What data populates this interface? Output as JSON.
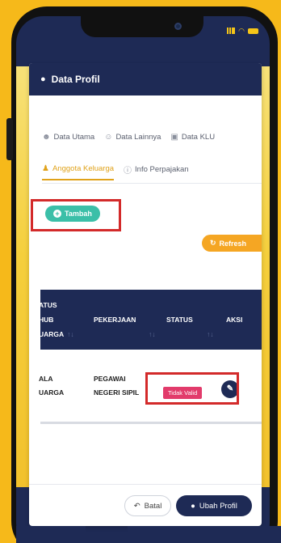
{
  "card": {
    "title": "Data Profil"
  },
  "tabs": [
    {
      "label": "Data Utama",
      "icon": "user-outline-icon"
    },
    {
      "label": "Data Lainnya",
      "icon": "user-group-icon"
    },
    {
      "label": "Data KLU",
      "icon": "cube-icon"
    },
    {
      "label": "Anggota Keluarga",
      "icon": "family-icon",
      "active": true
    },
    {
      "label": "Info Perpajakan",
      "icon": "info-circle-icon"
    }
  ],
  "actions": {
    "tambah": "Tambah",
    "refresh": "Refresh"
  },
  "table": {
    "headers": [
      {
        "line1": "ATUS",
        "line2": "HUB",
        "line3": "UARGA"
      },
      {
        "label": "PEKERJAAN"
      },
      {
        "label": "STATUS"
      },
      {
        "label": "AKSI"
      }
    ],
    "rows": [
      {
        "hub_line1": "ALA",
        "hub_line2": "UARGA",
        "pekerjaan_line1": "PEGAWAI",
        "pekerjaan_line2": "NEGERI SIPIL",
        "status": "Tidak Valid"
      }
    ]
  },
  "footer": {
    "batal": "Batal",
    "ubah": "Ubah Profil"
  },
  "colors": {
    "navy": "#1e2a55",
    "accent": "#f5a623",
    "teal": "#3bbfa8",
    "invalid": "#e23b6b",
    "highlight": "#d32a2a"
  }
}
